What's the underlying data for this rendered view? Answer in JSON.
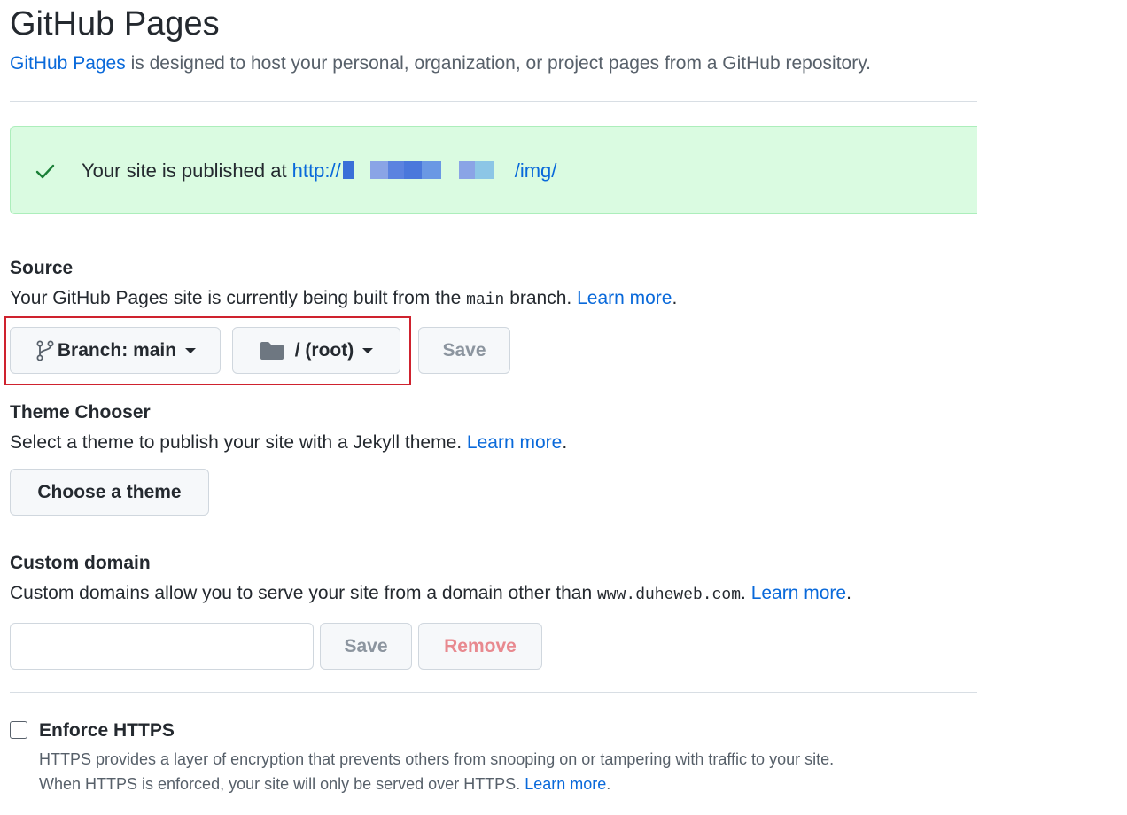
{
  "header": {
    "title": "GitHub Pages",
    "intro_link": "GitHub Pages",
    "intro_text": " is designed to host your personal, organization, or project pages from a GitHub repository."
  },
  "flash": {
    "icon": "check-icon",
    "text": "Your site is published at ",
    "url_prefix": "http://",
    "url_suffix": "/img/"
  },
  "source": {
    "title": "Source",
    "desc_pre": "Your GitHub Pages site is currently being built from the ",
    "desc_code": "main",
    "desc_post": " branch. ",
    "learn_more": "Learn more",
    "period": ".",
    "branch_label": "Branch: main",
    "folder_label": "/ (root)",
    "save_label": "Save"
  },
  "theme": {
    "title": "Theme Chooser",
    "desc": "Select a theme to publish your site with a Jekyll theme. ",
    "learn_more": "Learn more",
    "period": ".",
    "button": "Choose a theme"
  },
  "custom_domain": {
    "title": "Custom domain",
    "desc_pre": "Custom domains allow you to serve your site from a domain other than ",
    "desc_code": "www.duheweb.com",
    "desc_post": ". ",
    "learn_more": "Learn more",
    "period": ".",
    "input_value": "",
    "save_label": "Save",
    "remove_label": "Remove"
  },
  "https": {
    "label": "Enforce HTTPS",
    "checked": false,
    "note_line1": "HTTPS provides a layer of encryption that prevents others from snooping on or tampering with traffic to your site.",
    "note_line2": "When HTTPS is enforced, your site will only be served over HTTPS. ",
    "learn_more": "Learn more",
    "period": "."
  },
  "colors": {
    "link": "#0969da",
    "success_bg": "#dafbe1",
    "success_icon": "#1a7f37",
    "highlight": "#cf222e"
  }
}
